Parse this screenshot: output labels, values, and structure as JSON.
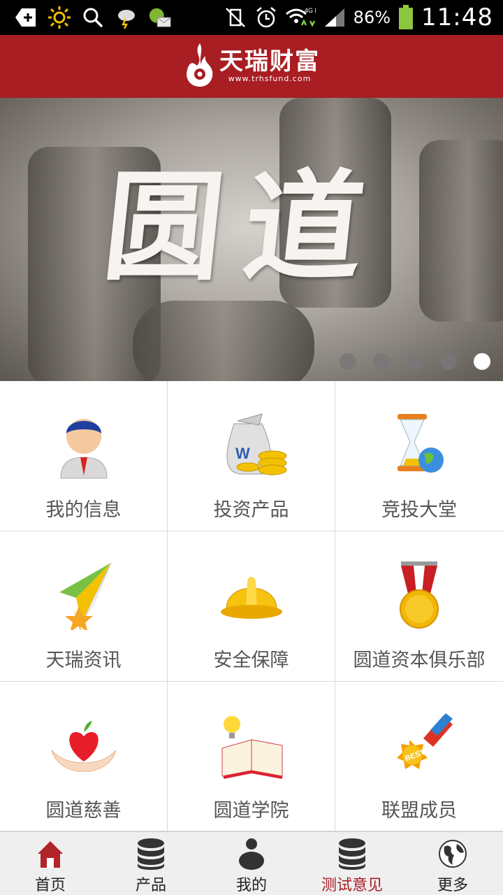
{
  "status_bar": {
    "icons": [
      "add-icon",
      "brightness-icon",
      "search-icon",
      "weather-icon",
      "mail-icon"
    ],
    "right_icons": [
      "no-vibrate-icon",
      "alarm-icon",
      "wifi-icon",
      "signal-icon",
      "battery-icon"
    ],
    "network_label": "4G LTE",
    "battery_percent": "86%",
    "time": "11:48"
  },
  "header": {
    "brand_name": "天瑞财富",
    "brand_url": "www.trhsfund.com",
    "accent_color": "#a81e23"
  },
  "banner": {
    "title": "圆道",
    "slide_count": 5,
    "active_slide": 5
  },
  "menu": {
    "items": [
      {
        "label": "我的信息",
        "icon": "user-profile-icon"
      },
      {
        "label": "投资产品",
        "icon": "money-bag-icon"
      },
      {
        "label": "竞投大堂",
        "icon": "hourglass-globe-icon"
      },
      {
        "label": "天瑞资讯",
        "icon": "paper-plane-icon"
      },
      {
        "label": "安全保障",
        "icon": "hard-hat-icon"
      },
      {
        "label": "圆道资本俱乐部",
        "icon": "medal-icon"
      },
      {
        "label": "圆道慈善",
        "icon": "heart-hands-icon"
      },
      {
        "label": "圆道学院",
        "icon": "book-bulb-icon"
      },
      {
        "label": "联盟成员",
        "icon": "best-badge-icon"
      }
    ]
  },
  "bottom_nav": {
    "items": [
      {
        "label": "首页",
        "icon": "home-icon"
      },
      {
        "label": "产品",
        "icon": "database-icon"
      },
      {
        "label": "我的",
        "icon": "person-icon"
      },
      {
        "label": "测试意见",
        "icon": "database-icon"
      },
      {
        "label": "更多",
        "icon": "globe-icon"
      }
    ],
    "active_index": 3
  }
}
